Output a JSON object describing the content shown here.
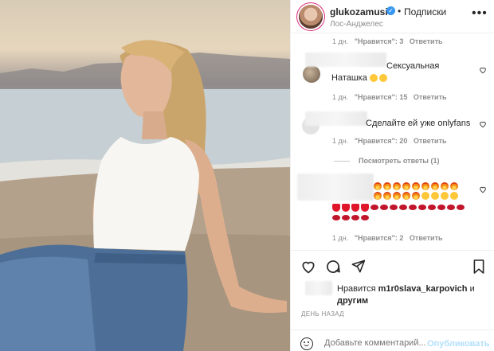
{
  "header": {
    "username": "glukozamusic",
    "follow_label": "Подписки",
    "location": "Лос-Анджелес",
    "more_icon": "more-horizontal-icon",
    "verified_icon": "verified-badge-icon"
  },
  "comments": [
    {
      "meta_time": "1 дн.",
      "meta_likes": "\"Нравится\": 3",
      "reply": "Ответить"
    },
    {
      "text": "Сексуальная Наташка",
      "meta_time": "1 дн.",
      "meta_likes": "\"Нравится\": 15",
      "reply": "Ответить"
    },
    {
      "text": "Сделайте ей уже onlyfans",
      "meta_time": "1 дн.",
      "meta_likes": "\"Нравится\": 20",
      "reply": "Ответить",
      "view_replies": "Посмотреть ответы (1)"
    },
    {
      "meta_time": "1 дн.",
      "meta_likes": "\"Нравится\": 2",
      "reply": "Ответить"
    }
  ],
  "actions": {
    "like_icon": "heart-icon",
    "comment_icon": "comment-icon",
    "share_icon": "send-icon",
    "save_icon": "bookmark-icon"
  },
  "likes": {
    "prefix": "Нравится",
    "user": "m1r0slava_karpovich",
    "suffix": "и",
    "others": "другим"
  },
  "time_ago": "ДЕНЬ НАЗАД",
  "comment_box": {
    "placeholder": "Добавьте комментарий...",
    "post_label": "Опубликовать",
    "emoji_icon": "smile-icon"
  },
  "colors": {
    "accent_blue": "#0095f6",
    "post_disabled": "#b2dffc",
    "verified": "#3897f0",
    "text": "#262626",
    "muted": "#8e8e8e"
  }
}
